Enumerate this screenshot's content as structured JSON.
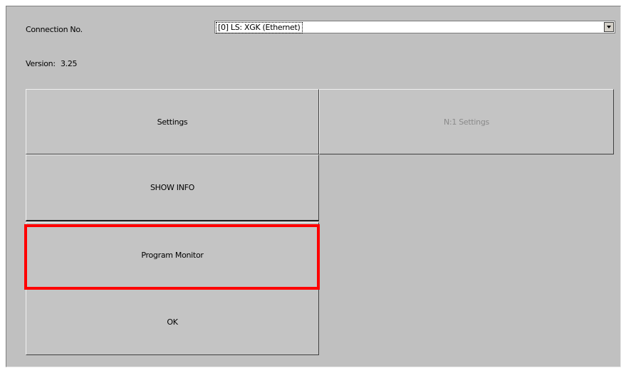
{
  "connection": {
    "label": "Connection No.",
    "selected": "[0] LS: XGK (Ethernet)"
  },
  "version": {
    "label": "Version:",
    "value": "3.25"
  },
  "buttons": {
    "settings": "Settings",
    "n1_settings": "N:1 Settings",
    "show_info": "SHOW INFO",
    "program_monitor": "Program Monitor",
    "ok": "OK"
  },
  "colors": {
    "panel_background": "#c0c0c0",
    "highlight": "#ff0000",
    "disabled_text": "#8a8a8a"
  },
  "icons": {
    "dropdown": "chevron-down-icon"
  }
}
